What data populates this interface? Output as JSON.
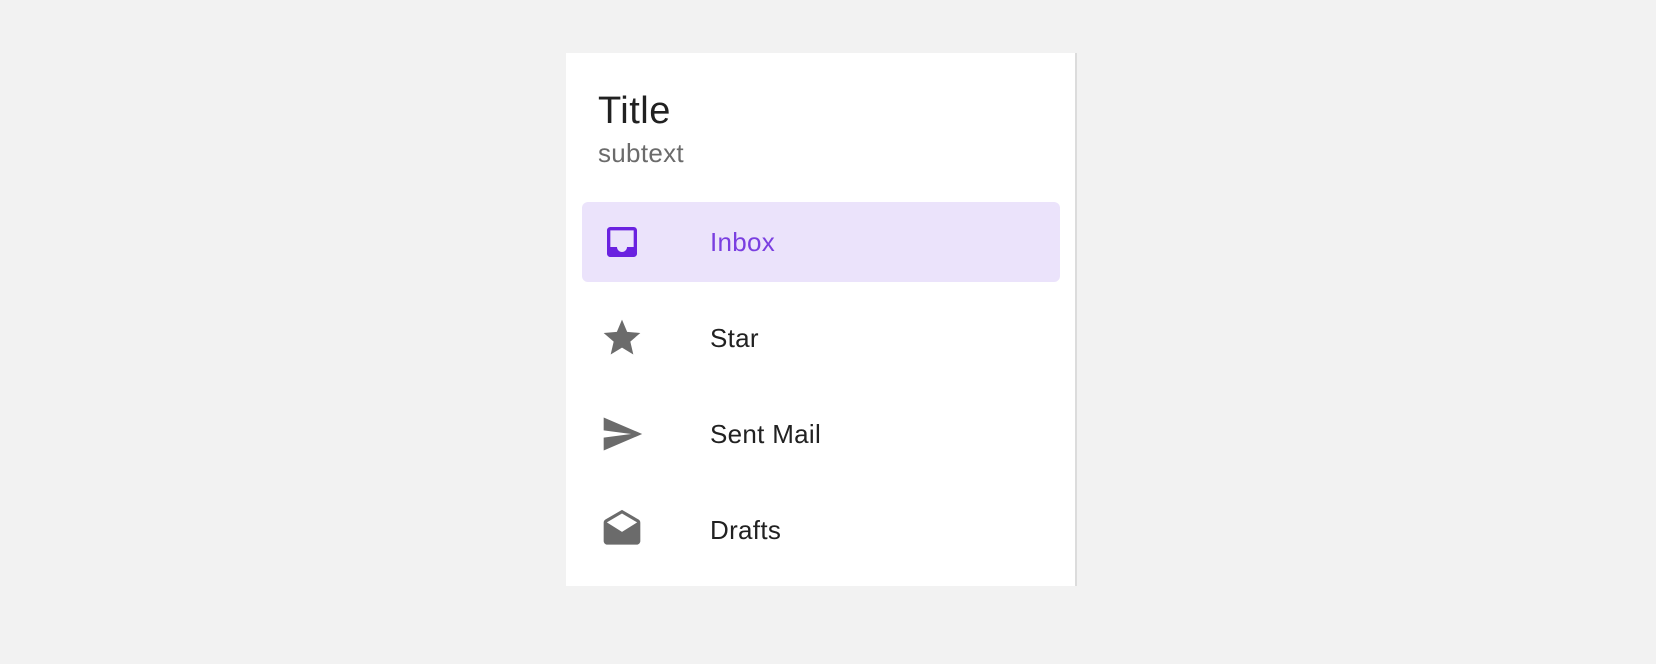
{
  "drawer": {
    "title": "Title",
    "subtitle": "subtext"
  },
  "nav": {
    "items": [
      {
        "label": "Inbox",
        "icon": "inbox-icon",
        "active": true
      },
      {
        "label": "Star",
        "icon": "star-icon",
        "active": false
      },
      {
        "label": "Sent Mail",
        "icon": "send-icon",
        "active": false
      },
      {
        "label": "Drafts",
        "icon": "drafts-icon",
        "active": false
      }
    ]
  },
  "colors": {
    "accent": "#6a22e0",
    "active_background": "#ebe3fb",
    "icon_default": "#6b6b6b",
    "text_primary": "#212121",
    "text_secondary": "#6b6b6b",
    "page_background": "#f2f2f2"
  }
}
